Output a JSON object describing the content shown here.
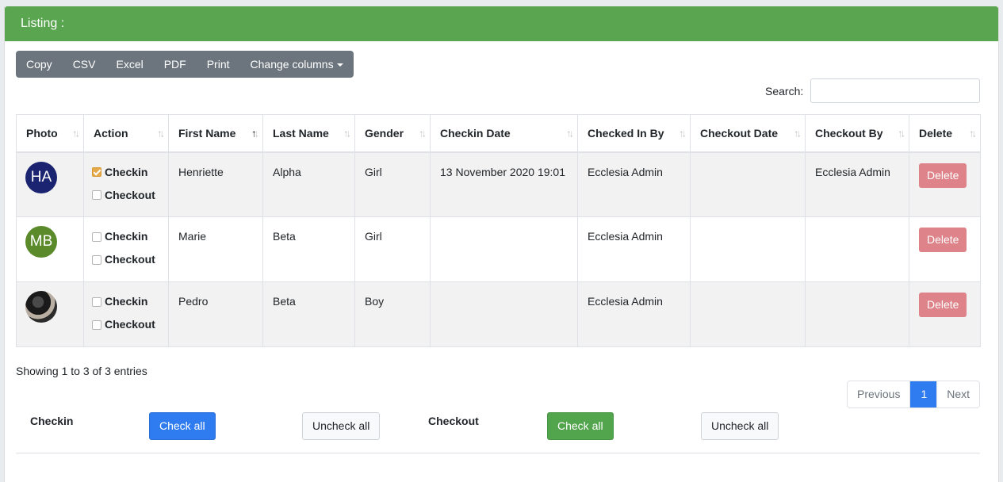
{
  "header": {
    "title": "Listing :"
  },
  "toolbar": {
    "buttons": [
      "Copy",
      "CSV",
      "Excel",
      "PDF",
      "Print"
    ],
    "change_columns": "Change columns"
  },
  "search": {
    "label": "Search:",
    "value": ""
  },
  "table": {
    "columns": [
      "Photo",
      "Action",
      "First Name",
      "Last Name",
      "Gender",
      "Checkin Date",
      "Checked In By",
      "Checkout Date",
      "Checkout By",
      "Delete"
    ],
    "sorted_column": "First Name",
    "sort_direction": "ascending",
    "checkin_label": "Checkin",
    "checkout_label": "Checkout",
    "delete_label": "Delete",
    "rows": [
      {
        "avatar": "HA",
        "avatar_color": "#1b2470",
        "checkin": true,
        "checkout": false,
        "first_name": "Henriette",
        "last_name": "Alpha",
        "gender": "Girl",
        "checkin_date": "13 November 2020 19:01",
        "checked_in_by": "Ecclesia Admin",
        "checkout_date": "",
        "checkout_by": "Ecclesia Admin"
      },
      {
        "avatar": "MB",
        "avatar_color": "#5a8a2a",
        "checkin": false,
        "checkout": false,
        "first_name": "Marie",
        "last_name": "Beta",
        "gender": "Girl",
        "checkin_date": "",
        "checked_in_by": "Ecclesia Admin",
        "checkout_date": "",
        "checkout_by": ""
      },
      {
        "avatar": "",
        "avatar_color": "",
        "avatar_is_photo": true,
        "checkin": false,
        "checkout": false,
        "first_name": "Pedro",
        "last_name": "Beta",
        "gender": "Boy",
        "checkin_date": "",
        "checked_in_by": "Ecclesia Admin",
        "checkout_date": "",
        "checkout_by": ""
      }
    ]
  },
  "info": "Showing 1 to 3 of 3 entries",
  "pagination": {
    "previous": "Previous",
    "current": "1",
    "next": "Next"
  },
  "bulk": {
    "checkin_label": "Checkin",
    "checkout_label": "Checkout",
    "check_all": "Check all",
    "uncheck_all": "Uncheck all"
  },
  "colors": {
    "header_green": "#5aa650",
    "primary": "#2f7bf0",
    "success": "#52a54d",
    "danger": "#dd8389",
    "toolbar": "#6c757d"
  }
}
